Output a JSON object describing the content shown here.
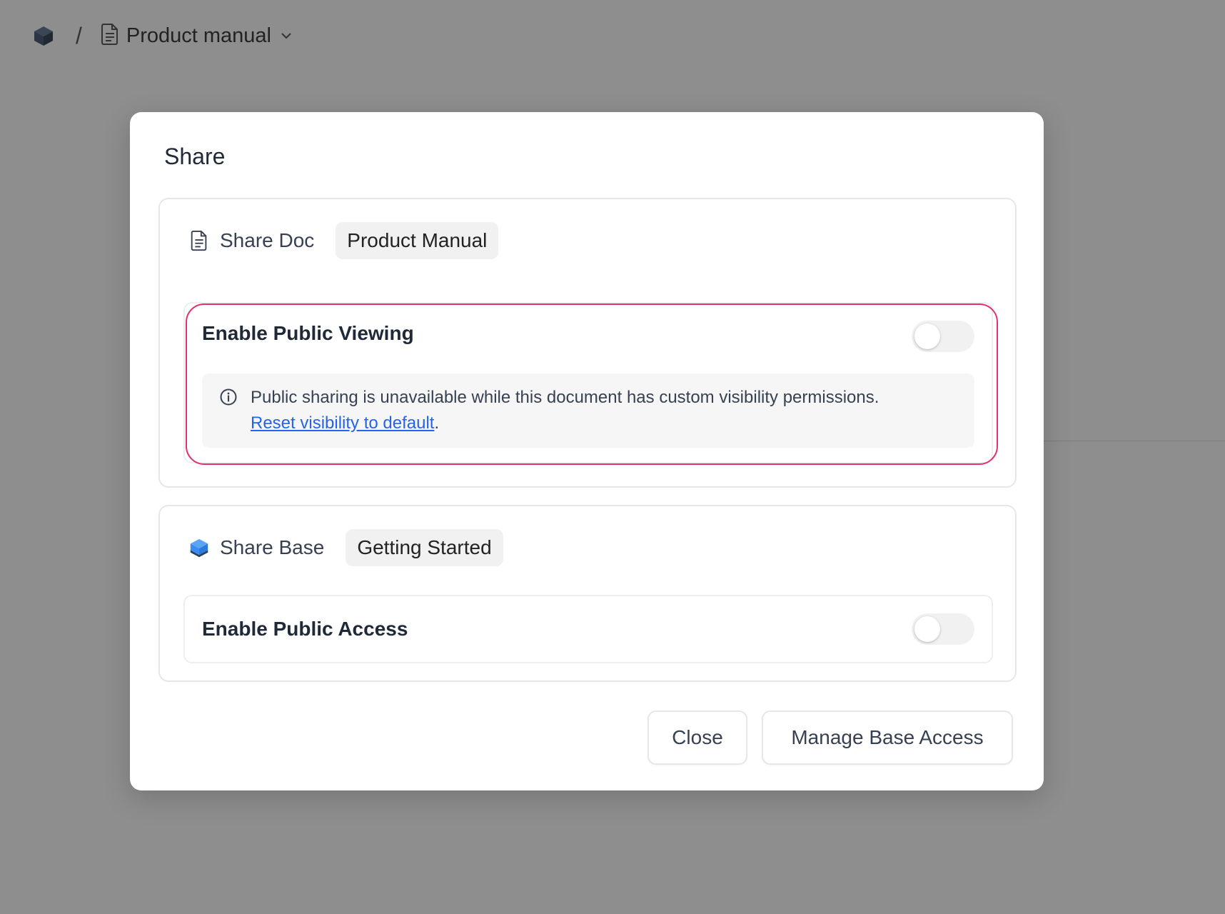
{
  "topbar": {
    "logo_icon": "base-cube-icon",
    "separator": "/",
    "doc_icon": "document-icon",
    "doc_title": "Product manual",
    "dropdown_icon": "chevron-down-icon"
  },
  "modal": {
    "title": "Share",
    "share_doc": {
      "icon": "document-icon",
      "label": "Share Doc",
      "doc_name": "Product Manual",
      "public_viewing_label": "Enable Public Viewing",
      "public_viewing_enabled": false,
      "notice": {
        "icon": "info-icon",
        "text": "Public sharing is unavailable while this document has custom visibility permissions.",
        "link_text": "Reset visibility to default",
        "trailing": "."
      }
    },
    "share_base": {
      "icon": "base-cube-icon",
      "label": "Share Base",
      "base_name": "Getting Started",
      "public_access_label": "Enable Public Access",
      "public_access_enabled": false
    },
    "buttons": {
      "close": "Close",
      "manage_base_access": "Manage Base Access"
    }
  },
  "colors": {
    "overlay": "#8e8e8e",
    "highlight": "#e0336e",
    "link": "#2563eb",
    "base_icon_top": "#3b8cf0",
    "base_icon_bottom": "#2f3e51"
  }
}
